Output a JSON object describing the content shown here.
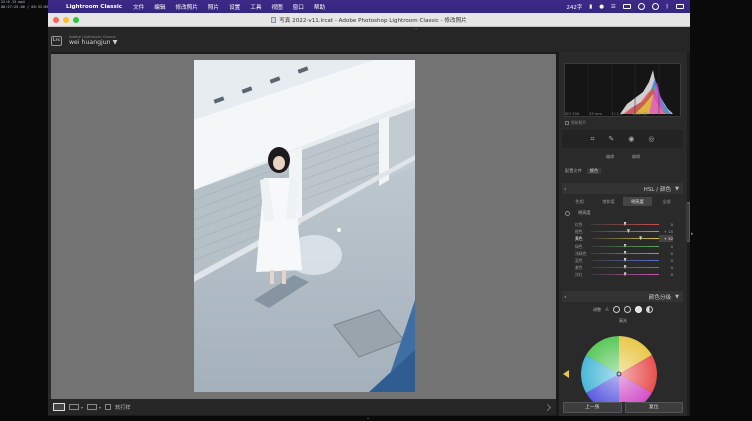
{
  "overlay": {
    "lines": [
      "22:0 13.mp4",
      "00:27:25.00 / 00:32:05.00"
    ]
  },
  "menubar": {
    "app": "Lightroom Classic",
    "items": [
      "文件",
      "编辑",
      "修改照片",
      "照片",
      "设置",
      "工具",
      "视图",
      "窗口",
      "帮助"
    ],
    "status_text": "242字"
  },
  "window": {
    "title": "写真 2022-v11.lrcat - Adobe Photoshop Lightroom Classic - 修改照片"
  },
  "identity": {
    "logo": "Lrc",
    "small": "Adobe Lightroom Classic",
    "user": "wei huangjun",
    "user_caret": "▼"
  },
  "histogram": {
    "info": [
      "ISO 200",
      "35 mm",
      "f / 1.8",
      "1/400 秒"
    ],
    "original_label": "原始照片"
  },
  "panel": {
    "mini_tabs": [
      "编辑",
      "编辑"
    ],
    "preset_label": "配置文件",
    "preset_value": "颜色",
    "hsl_header": "HSL / 颜色",
    "hsl_tabs": [
      "色相",
      "饱和度",
      "明亮度",
      "全部"
    ],
    "hsl_selected_tab": 2,
    "hsl_sub": "明亮度",
    "sliders": [
      {
        "label": "红色",
        "value": "0"
      },
      {
        "label": "橙色",
        "value": "+ 15"
      },
      {
        "label": "黄色",
        "value": "+ 32"
      },
      {
        "label": "绿色",
        "value": "0"
      },
      {
        "label": "浅绿色",
        "value": "0"
      },
      {
        "label": "蓝色",
        "value": "0"
      },
      {
        "label": "紫色",
        "value": "0"
      },
      {
        "label": "洋红",
        "value": "0"
      }
    ],
    "slider_positions": [
      0.5,
      0.55,
      0.73,
      0.5,
      0.5,
      0.5,
      0.5,
      0.5
    ],
    "slider_colors": [
      "#c95050",
      "#d88a3c",
      "#d6c84a",
      "#5aa85a",
      "#5ab3b3",
      "#5a6fd0",
      "#8a5ad0",
      "#c85ab0"
    ],
    "highlight_slider": 2,
    "color_grading_header": "颜色分级",
    "cg_adjust_label": "调整",
    "cg_mid_label": "高光",
    "buttons": [
      "上一张",
      "复位"
    ]
  },
  "toolbar": {
    "softproof_label": "软打样"
  }
}
